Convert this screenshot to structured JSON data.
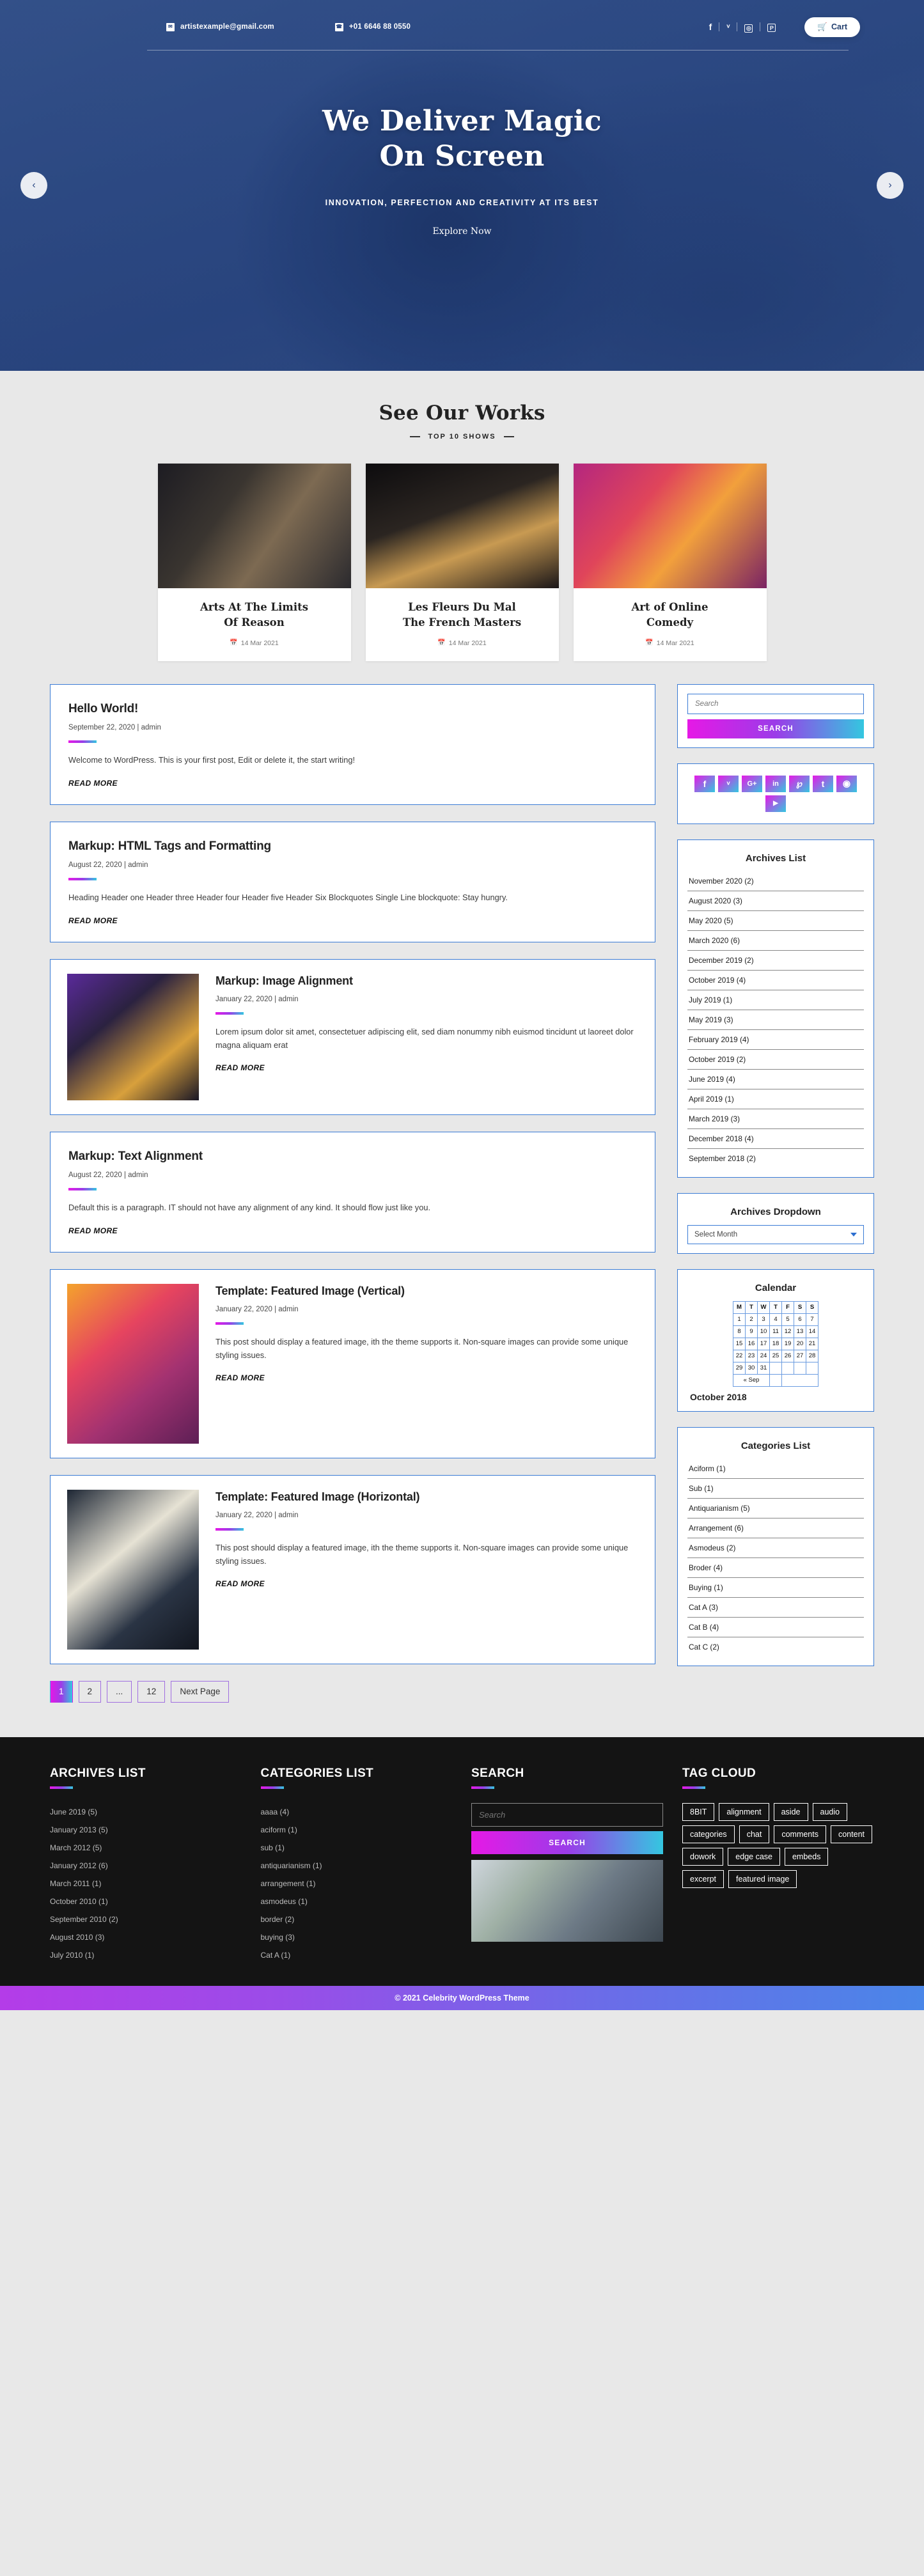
{
  "topbar": {
    "email": "artistexample@gmail.com",
    "phone": "+01 6646 88 0550",
    "cart_label": "Cart",
    "social": [
      "f",
      "t",
      "in",
      "p"
    ]
  },
  "hero": {
    "title_line1": "We Deliver Magic",
    "title_line2": "On Screen",
    "subtitle": "INNOVATION, PERFECTION AND CREATIVITY AT ITS BEST",
    "cta": "Explore Now",
    "prev_label": "‹",
    "next_label": "›"
  },
  "works": {
    "title": "See Our Works",
    "subtitle": "TOP 10 SHOWS",
    "cards": [
      {
        "title_line1": "Arts At The Limits",
        "title_line2": "Of Reason",
        "date": "14 Mar 2021"
      },
      {
        "title_line1": "Les Fleurs Du Mal",
        "title_line2": "The French Masters",
        "date": "14 Mar 2021"
      },
      {
        "title_line1": "Art of Online",
        "title_line2": "Comedy",
        "date": "14 Mar 2021"
      }
    ]
  },
  "posts": [
    {
      "title": "Hello World!",
      "meta": "September 22, 2020 | admin",
      "text": "Welcome to WordPress. This is your first post, Edit or delete it, the start writing!",
      "read_more": "READ MORE",
      "has_image": false
    },
    {
      "title": "Markup: HTML Tags and Formatting",
      "meta": "August 22, 2020 | admin",
      "text": "Heading Header one Header three Header four Header five Header Six Blockquotes Single Line blockquote: Stay hungry.",
      "read_more": "READ MORE",
      "has_image": false
    },
    {
      "title": "Markup: Image Alignment",
      "meta": "January 22, 2020 | admin",
      "text": "Lorem ipsum dolor sit amet, consectetuer adipiscing elit, sed diam nonummy nibh euismod tincidunt ut laoreet dolor magna aliquam erat",
      "read_more": "READ MORE",
      "has_image": true
    },
    {
      "title": "Markup: Text Alignment",
      "meta": "August 22, 2020 | admin",
      "text": "Default this is a paragraph. IT should not have any alignment of any kind. It should flow just like you.",
      "read_more": "READ MORE",
      "has_image": false
    },
    {
      "title": "Template: Featured Image (Vertical)",
      "meta": "January 22, 2020 | admin",
      "text": "This post should display a featured image, ith the theme supports it. Non-square images can provide some unique styling issues.",
      "read_more": "READ MORE",
      "has_image": true
    },
    {
      "title": "Template: Featured Image (Horizontal)",
      "meta": "January 22, 2020 | admin",
      "text": "This post should display a featured image, ith the theme supports it. Non-square images can provide some unique styling issues.",
      "read_more": "READ MORE",
      "has_image": true
    }
  ],
  "pagination": [
    {
      "label": "1",
      "active": true
    },
    {
      "label": "2",
      "active": false
    },
    {
      "label": "...",
      "active": false
    },
    {
      "label": "12",
      "active": false
    },
    {
      "label": "Next Page",
      "active": false
    }
  ],
  "sidebar": {
    "search": {
      "placeholder": "Search",
      "button": "SEARCH"
    },
    "social_icons": [
      "f",
      "ᵛ",
      "G+",
      "in",
      "℗",
      "t",
      "◎",
      "▶"
    ],
    "archives": {
      "title": "Archives List",
      "items": [
        "November 2020 (2)",
        "August 2020 (3)",
        "May 2020 (5)",
        "March 2020 (6)",
        "December 2019 (2)",
        "October 2019 (4)",
        "July 2019 (1)",
        "May 2019 (3)",
        "February 2019 (4)",
        "October 2019 (2)",
        "June 2019 (4)",
        "April 2019 (1)",
        "March 2019 (3)",
        "December 2018 (4)",
        "September 2018 (2)"
      ]
    },
    "archives_dropdown": {
      "title": "Archives Dropdown",
      "selected": "Select Month"
    },
    "calendar": {
      "title": "Calendar",
      "weekdays": [
        "M",
        "T",
        "W",
        "T",
        "F",
        "S",
        "S"
      ],
      "weeks": [
        [
          "1",
          "2",
          "3",
          "4",
          "5",
          "6",
          "7"
        ],
        [
          "8",
          "9",
          "10",
          "11",
          "12",
          "13",
          "14"
        ],
        [
          "15",
          "16",
          "17",
          "18",
          "19",
          "20",
          "21"
        ],
        [
          "22",
          "23",
          "24",
          "25",
          "26",
          "27",
          "28"
        ],
        [
          "29",
          "30",
          "31",
          "",
          "",
          "",
          ""
        ]
      ],
      "prev": "« Sep",
      "month_label": "October 2018"
    },
    "categories": {
      "title": "Categories List",
      "items": [
        "Aciform (1)",
        "Sub (1)",
        "Antiquarianism (5)",
        "Arrangement (6)",
        "Asmodeus (2)",
        "Broder (4)",
        "Buying (1)",
        "Cat A (3)",
        "Cat B (4)",
        "Cat C (2)"
      ]
    }
  },
  "footer": {
    "archives": {
      "title": "ARCHIVES LIST",
      "items": [
        "June 2019 (5)",
        "January  2013 (5)",
        "March 2012 (5)",
        "January  2012 (6)",
        "March  2011 (1)",
        "October 2010 (1)",
        "September 2010 (2)",
        "August 2010 (3)",
        "July 2010 (1)"
      ]
    },
    "categories": {
      "title": "CATEGORIES LIST",
      "items": [
        "aaaa (4)",
        "aciform (1)",
        "sub (1)",
        "antiquarianism (1)",
        "arrangement (1)",
        "asmodeus (1)",
        "border (2)",
        "buying (3)",
        "Cat A (1)"
      ]
    },
    "search": {
      "title": "SEARCH",
      "placeholder": "Search",
      "button": "SEARCH"
    },
    "tagcloud": {
      "title": "TAG CLOUD",
      "tags": [
        "8BIT",
        "alignment",
        "aside",
        "audio",
        "categories",
        "chat",
        "comments",
        "content",
        "dowork",
        "edge case",
        "embeds",
        "excerpt",
        "featured image"
      ]
    },
    "copyright": "© 2021 Celebrity WordPress Theme"
  },
  "colors": {
    "accent_start": "#e619e6",
    "accent_mid": "#9b3ce8",
    "accent_end": "#34c7e0",
    "border_blue": "#3a7bd5",
    "hero_blue": "#2d4a85"
  }
}
